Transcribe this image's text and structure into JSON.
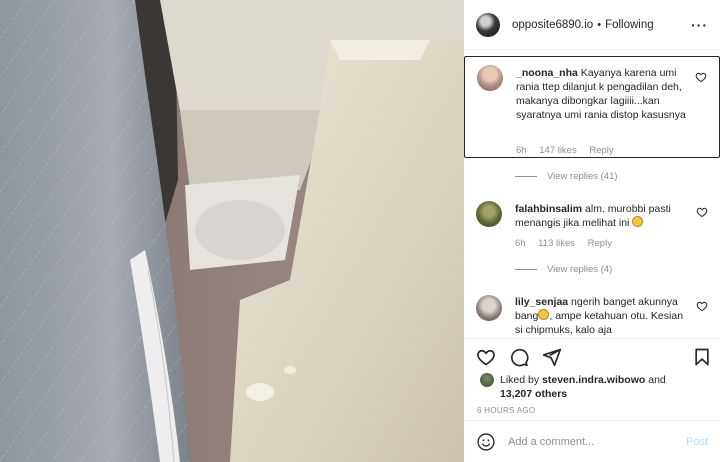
{
  "header": {
    "username": "opposite6890.io",
    "separator": "•",
    "follow_status": "Following",
    "more": "···"
  },
  "comments": [
    {
      "username": "_noona_nha",
      "text": "Kayanya karena umi rania ttep dilanjut k pengadilan deh, makanya dibongkar lagiiii...kan syaratnya umi rania distop kasusnya",
      "time": "6h",
      "likes": "147 likes",
      "reply": "Reply",
      "view_replies": "",
      "highlighted": true
    },
    {
      "username": "falahbinsalim",
      "text": "alm. murobbi pasti menangis jika melihat ini",
      "time": "6h",
      "likes": "113 likes",
      "reply": "Reply",
      "view_replies": "View replies (4)",
      "highlighted": false
    },
    {
      "username": "lily_senjaa",
      "text": "ngerih banget akunnya bang",
      "text_after": ", ampe ketahuan otu. Kesian si chipmuks, kalo aja",
      "time": "",
      "likes": "",
      "reply": "",
      "view_replies": "",
      "highlighted": false
    }
  ],
  "first_view_replies": "View replies (41)",
  "actions": {
    "like_icon": "heart-icon",
    "comment_icon": "comment-icon",
    "share_icon": "share-icon",
    "save_icon": "bookmark-icon"
  },
  "likes": {
    "prefix": "Liked by",
    "user": "steven.indra.wibowo",
    "and": "and",
    "others": "13,207 others"
  },
  "timestamp": "6 HOURS AGO",
  "add_comment": {
    "placeholder": "Add a comment...",
    "post_label": "Post"
  },
  "colors": {
    "text": "#262626",
    "muted": "#8e8e8e",
    "post_disabled": "#b2dffc",
    "border": "#efefef"
  }
}
